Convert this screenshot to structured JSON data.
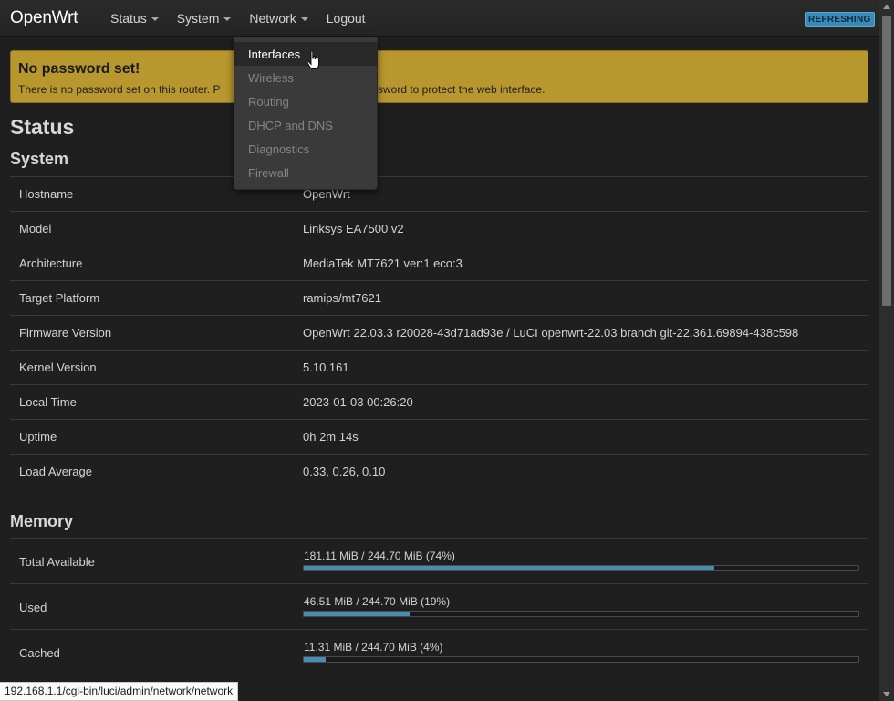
{
  "navbar": {
    "brand": "OpenWrt",
    "menu": [
      {
        "label": "Status",
        "has_caret": true
      },
      {
        "label": "System",
        "has_caret": true
      },
      {
        "label": "Network",
        "has_caret": true
      },
      {
        "label": "Logout",
        "has_caret": false
      }
    ],
    "badge": "REFRESHING"
  },
  "dropdown": {
    "items": [
      "Interfaces",
      "Wireless",
      "Routing",
      "DHCP and DNS",
      "Diagnostics",
      "Firewall"
    ],
    "active_index": 0
  },
  "alert": {
    "title": "No password set!",
    "text_left": "There is no password set on this router. P",
    "text_right": "sword to protect the web interface."
  },
  "page_title": "Status",
  "system": {
    "title": "System",
    "rows": [
      {
        "key": "Hostname",
        "value": "OpenWrt"
      },
      {
        "key": "Model",
        "value": "Linksys EA7500 v2"
      },
      {
        "key": "Architecture",
        "value": "MediaTek MT7621 ver:1 eco:3"
      },
      {
        "key": "Target Platform",
        "value": "ramips/mt7621"
      },
      {
        "key": "Firmware Version",
        "value": "OpenWrt 22.03.3 r20028-43d71ad93e / LuCI openwrt-22.03 branch git-22.361.69894-438c598"
      },
      {
        "key": "Kernel Version",
        "value": "5.10.161"
      },
      {
        "key": "Local Time",
        "value": "2023-01-03 00:26:20"
      },
      {
        "key": "Uptime",
        "value": "0h 2m 14s"
      },
      {
        "key": "Load Average",
        "value": "0.33, 0.26, 0.10"
      }
    ]
  },
  "memory": {
    "title": "Memory",
    "rows": [
      {
        "key": "Total Available",
        "value": "181.11 MiB / 244.70 MiB (74%)",
        "percent": 74
      },
      {
        "key": "Used",
        "value": "46.51 MiB / 244.70 MiB (19%)",
        "percent": 19
      },
      {
        "key": "Cached",
        "value": "11.31 MiB / 244.70 MiB (4%)",
        "percent": 4
      }
    ]
  },
  "statusbar": {
    "url": "192.168.1.1/cgi-bin/luci/admin/network/network"
  },
  "colors": {
    "background": "#1f1f1f",
    "alert": "#b8972e",
    "progress": "#4b8cb3",
    "badge": "#3a8ab8"
  }
}
